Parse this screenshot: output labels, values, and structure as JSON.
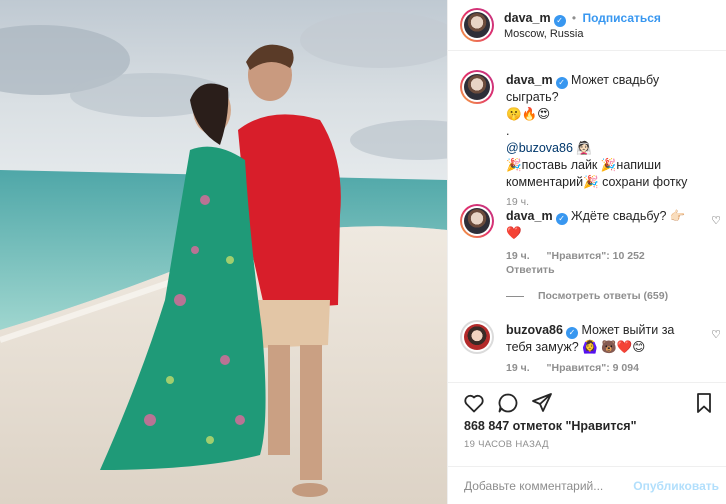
{
  "header": {
    "username": "dava_m",
    "follow_label": "Подписаться",
    "location": "Moscow, Russia",
    "dot": "•"
  },
  "caption": {
    "username": "dava_m",
    "line1": "Может свадьбу сыграть?",
    "line1_emoji": "🤫🔥😍",
    "line2": ".",
    "mention": "@buzova86",
    "mention_emoji": "👰🏻",
    "line4": "🎉поставь лайк 🎉напиши",
    "line5": "комментарий🎉 сохрани фотку",
    "time": "19 ч."
  },
  "comments": [
    {
      "username": "dava_m",
      "text": "Ждёте свадьбу? 👉🏻",
      "text2": "❤️",
      "time": "19 ч.",
      "likes": "\"Нравится\": 10 252",
      "reply": "Ответить",
      "view_replies": "Посмотреть ответы (659)"
    },
    {
      "username": "buzova86",
      "text": "Может выйти за",
      "text2": "тебя замуж? 🙆‍♀️ 🐻❤️😊",
      "time": "19 ч.",
      "likes": "\"Нравится\": 9 094"
    }
  ],
  "actions": {
    "likes_count": "868 847 отметок \"Нравится\"",
    "posted_ago": "19 ЧАСОВ НАЗАД",
    "comment_placeholder": "Добавьте комментарий...",
    "publish_label": "Опубликовать"
  },
  "colors": {
    "accent": "#3897f0",
    "publish_disabled": "#b2dffc",
    "muted": "#8e8e8e",
    "heart_red": "#ed4956"
  },
  "icons": [
    "heart-icon",
    "comment-icon",
    "share-icon",
    "bookmark-icon",
    "verified-icon",
    "small-heart-icon"
  ]
}
